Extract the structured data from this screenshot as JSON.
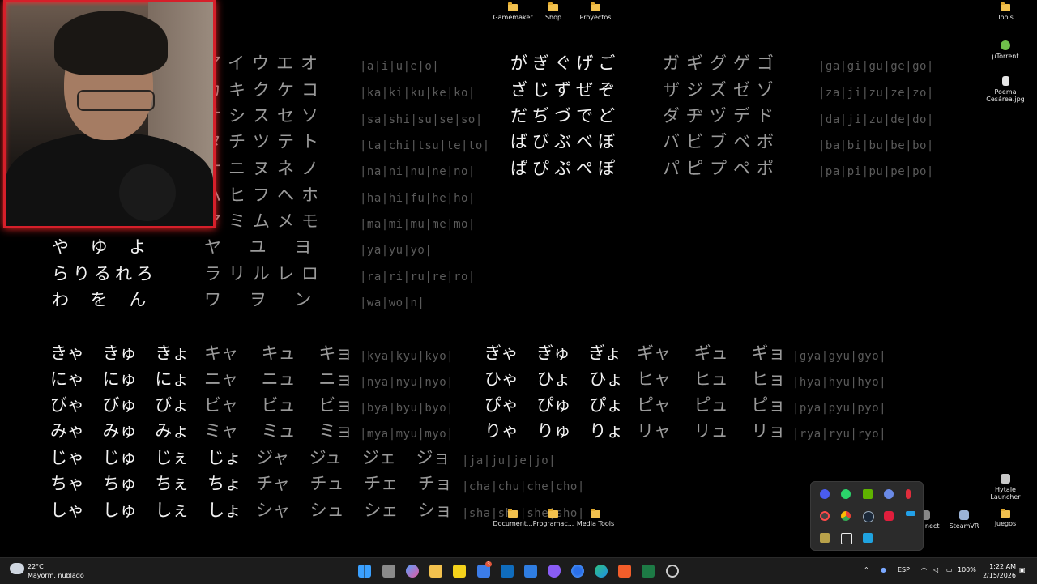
{
  "desktop_icons_top": [
    {
      "label": "Gamemaker"
    },
    {
      "label": "Shop"
    },
    {
      "label": "Proyectos"
    }
  ],
  "desktop_icons_right": [
    {
      "label": "Tools"
    },
    {
      "label": "µTorrent"
    },
    {
      "label": "Poema Cesárea.jpg"
    }
  ],
  "desktop_icons_bottom": [
    {
      "label": "Document..."
    },
    {
      "label": "Programac..."
    },
    {
      "label": "Media Tools"
    }
  ],
  "desktop_icons_bottom_right": [
    {
      "label": "soft nect"
    },
    {
      "label": "SteamVR"
    },
    {
      "label": "juegos"
    },
    {
      "label": "Hytale Launcher"
    }
  ],
  "kana_rows": [
    {
      "kata": "アイウエオ",
      "romaji": "|a|i|u|e|o|"
    },
    {
      "kata": "カキクケコ",
      "romaji": "|ka|ki|ku|ke|ko|"
    },
    {
      "kata": "サシスセソ",
      "romaji": "|sa|shi|su|se|so|"
    },
    {
      "kata": "タチツテト",
      "romaji": "|ta|chi|tsu|te|to|"
    },
    {
      "kata": "ナニヌネノ",
      "romaji": "|na|ni|nu|ne|no|"
    },
    {
      "kata": "ハヒフヘホ",
      "romaji": "|ha|hi|fu|he|ho|"
    },
    {
      "kata": "マミムメモ",
      "romaji": "|ma|mi|mu|me|mo|"
    },
    {
      "hira": "や ゆ よ",
      "kata": "ヤ ユ ヨ",
      "romaji": "|ya|yu|yo|"
    },
    {
      "hira": "らりるれろ",
      "kata": "ラリルレロ",
      "romaji": "|ra|ri|ru|re|ro|"
    },
    {
      "hira": "わ を ん",
      "kata": "ワ ヲ ン",
      "romaji": "|wa|wo|n|"
    }
  ],
  "dakuten_rows": [
    {
      "hira": "がぎぐげご",
      "kata": "ガギグゲゴ",
      "romaji": "|ga|gi|gu|ge|go|"
    },
    {
      "hira": "ざじずぜぞ",
      "kata": "ザジズゼゾ",
      "romaji": "|za|ji|zu|ze|zo|"
    },
    {
      "hira": "だぢづでど",
      "kata": "ダヂヅデド",
      "romaji": "|da|ji|zu|de|do|"
    },
    {
      "hira": "ばびぶべぼ",
      "kata": "バビブベボ",
      "romaji": "|ba|bi|bu|be|bo|"
    },
    {
      "hira": "ぱぴぷぺぽ",
      "kata": "パピプペポ",
      "romaji": "|pa|pi|pu|pe|po|"
    }
  ],
  "combo_left": [
    {
      "hira": "きゃ きゅ きょ",
      "kata": "キャ キュ キョ",
      "romaji": "|kya|kyu|kyo|"
    },
    {
      "hira": "にゃ にゅ にょ",
      "kata": "ニャ ニュ ニョ",
      "romaji": "|nya|nyu|nyo|"
    },
    {
      "hira": "びゃ びゅ びょ",
      "kata": "ビャ ビュ ビョ",
      "romaji": "|bya|byu|byo|"
    },
    {
      "hira": "みゃ みゅ みょ",
      "kata": "ミャ ミュ ミョ",
      "romaji": "|mya|myu|myo|"
    }
  ],
  "combo_right": [
    {
      "hira": "ぎゃ ぎゅ ぎょ",
      "kata": "ギャ ギュ ギョ",
      "romaji": "|gya|gyu|gyo|"
    },
    {
      "hira": "ひゃ ひょ ひょ",
      "kata": "ヒャ ヒュ ヒョ",
      "romaji": "|hya|hyu|hyo|"
    },
    {
      "hira": "ぴゃ ぴゅ ぴょ",
      "kata": "ピャ ピュ ピョ",
      "romaji": "|pya|pyu|pyo|"
    },
    {
      "hira": "りゃ りゅ りょ",
      "kata": "リャ リュ リョ",
      "romaji": "|rya|ryu|ryo|"
    }
  ],
  "combo_j": [
    {
      "hira": "じゃ じゅ じぇ じょ",
      "kata": "ジャ ジュ ジェ ジョ",
      "romaji": "|ja|ju|je|jo|"
    },
    {
      "hira": "ちゃ ちゅ ちぇ ちょ",
      "kata": "チャ チュ チェ チョ",
      "romaji": "|cha|chu|che|cho|"
    },
    {
      "hira": "しゃ しゅ しぇ しょ",
      "kata": "シャ シュ シェ ショ",
      "romaji": "|sha|shu|she|sho|"
    }
  ],
  "taskbar": {
    "weather_temp": "22°C",
    "weather_desc": "Mayorm. nublado",
    "lang": "ESP",
    "battery": "100%",
    "time": "1:22 AM",
    "date": "2/15/2026",
    "badge": "3"
  },
  "colors": {
    "accent_red": "#d61f2a",
    "folder": "#f2c14e",
    "taskbar": "#1c1c1c"
  }
}
